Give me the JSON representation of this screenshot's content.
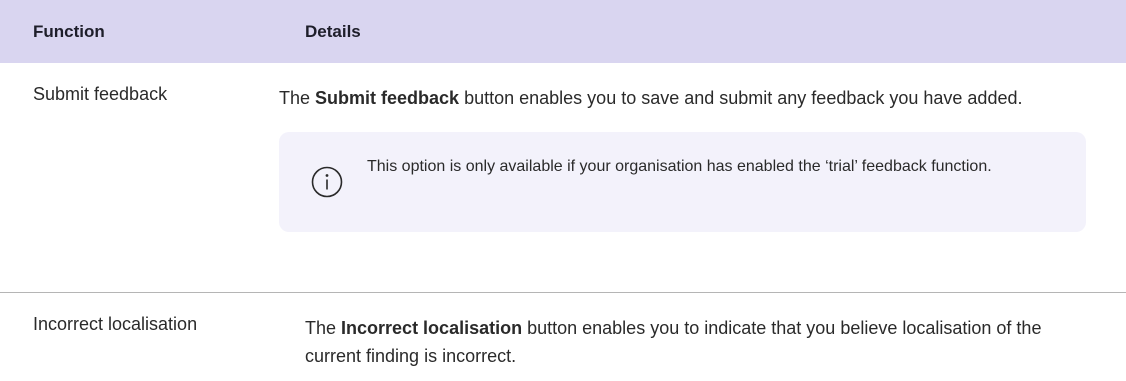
{
  "table": {
    "headers": {
      "function": "Function",
      "details": "Details"
    },
    "rows": [
      {
        "function": "Submit feedback",
        "details_prefix": "The ",
        "details_bold": "Submit feedback",
        "details_suffix": " button enables you to save and submit any feedback you have added.",
        "note": {
          "icon": "info-icon",
          "text": "This option is only available if your organisation has enabled the ‘trial’ feedback function."
        }
      },
      {
        "function": "Incorrect localisation",
        "details_prefix": "The ",
        "details_bold": "Incorrect localisation",
        "details_suffix": " button enables you to indicate that you believe localisation of the current finding is incorrect."
      }
    ]
  },
  "colors": {
    "header_bg": "#d9d5f0",
    "note_bg": "#f3f2fb",
    "divider": "#b5b5b5"
  }
}
